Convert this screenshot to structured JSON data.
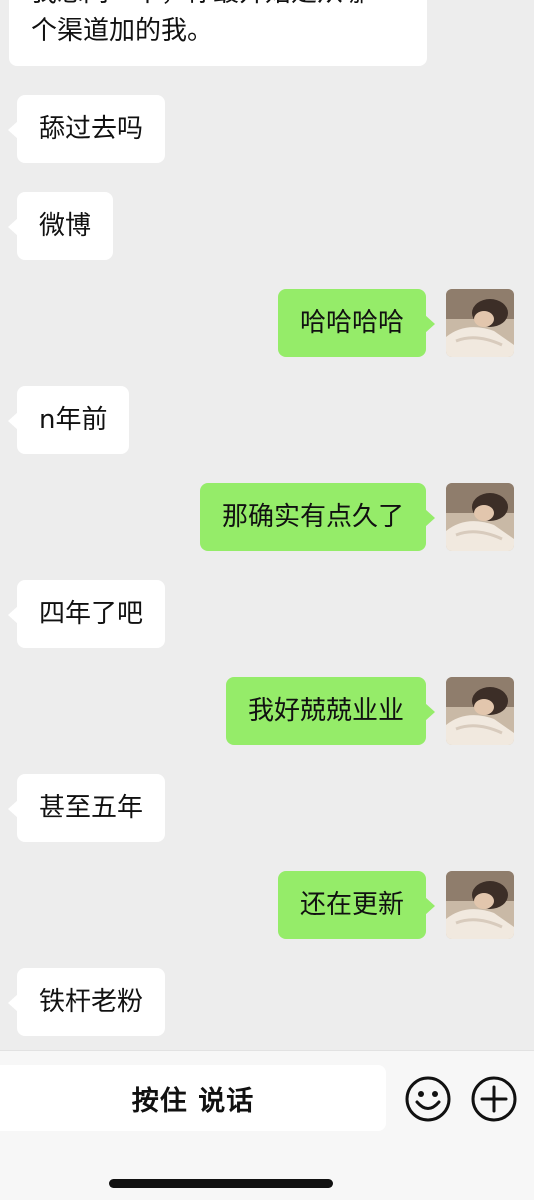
{
  "messages": [
    {
      "side": "in",
      "text": "个渠道加的我。",
      "partial": true,
      "prev_line": "我想问一下，你最开始是从哪"
    },
    {
      "side": "in",
      "text": "舔过去吗"
    },
    {
      "side": "in",
      "text": "微博"
    },
    {
      "side": "out",
      "text": "哈哈哈哈"
    },
    {
      "side": "in",
      "text": "n年前"
    },
    {
      "side": "out",
      "text": "那确实有点久了"
    },
    {
      "side": "in",
      "text": "四年了吧"
    },
    {
      "side": "out",
      "text": "我好兢兢业业"
    },
    {
      "side": "in",
      "text": "甚至五年"
    },
    {
      "side": "out",
      "text": "还在更新"
    },
    {
      "side": "in",
      "text": "铁杆老粉"
    }
  ],
  "input_bar": {
    "hold_to_talk_label": "按住 说话",
    "emoji_icon": "smiley-face-icon",
    "plus_icon": "plus-circle-icon"
  },
  "colors": {
    "background": "#ededed",
    "incoming_bubble": "#ffffff",
    "outgoing_bubble": "#95ec69",
    "bottom_bar": "#f7f7f7"
  }
}
